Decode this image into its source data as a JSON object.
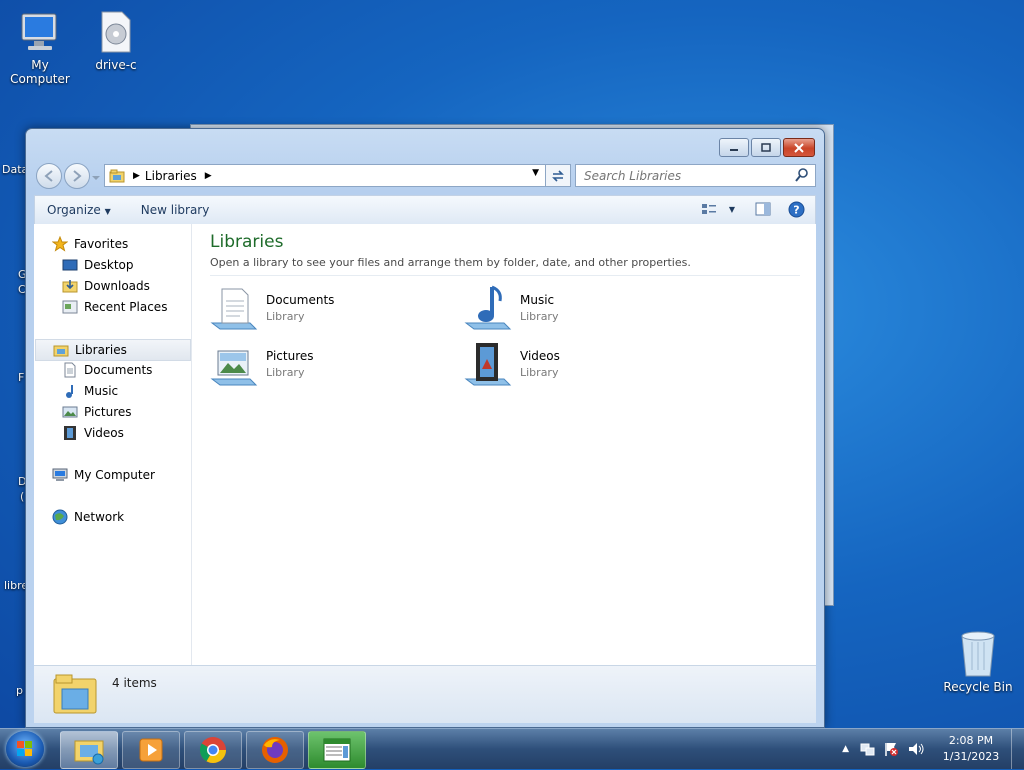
{
  "desktop": {
    "icons": [
      {
        "label": "My Computer",
        "icon": "computer-icon"
      },
      {
        "label": "drive-c",
        "icon": "disc-drive-icon"
      },
      {
        "label": "Recycle Bin",
        "icon": "recycle-bin-icon"
      }
    ],
    "partial_labels": [
      "Data",
      "G",
      "C",
      "F",
      "D",
      "(",
      "libre",
      "p"
    ]
  },
  "window": {
    "address": {
      "root_icon": "libraries-icon",
      "segments": [
        "Libraries"
      ]
    },
    "search_placeholder": "Search Libraries",
    "toolbar": {
      "organize": "Organize",
      "new_library": "New library"
    },
    "nav": {
      "favorites": {
        "label": "Favorites",
        "items": [
          "Desktop",
          "Downloads",
          "Recent Places"
        ]
      },
      "libraries": {
        "label": "Libraries",
        "items": [
          "Documents",
          "Music",
          "Pictures",
          "Videos"
        ]
      },
      "computer": "My Computer",
      "network": "Network"
    },
    "main": {
      "title": "Libraries",
      "subtitle": "Open a library to see your files and arrange them by folder, date, and other properties.",
      "libraries": [
        {
          "name": "Documents",
          "type": "Library",
          "icon": "documents-library-icon"
        },
        {
          "name": "Music",
          "type": "Library",
          "icon": "music-library-icon"
        },
        {
          "name": "Pictures",
          "type": "Library",
          "icon": "pictures-library-icon"
        },
        {
          "name": "Videos",
          "type": "Library",
          "icon": "videos-library-icon"
        }
      ]
    },
    "status": {
      "count": "4 items"
    }
  },
  "taskbar": {
    "apps": [
      "windows-explorer-icon",
      "media-player-icon",
      "chrome-icon",
      "firefox-icon",
      "spreadsheet-app-icon"
    ],
    "clock": {
      "time": "2:08 PM",
      "date": "1/31/2023"
    }
  }
}
